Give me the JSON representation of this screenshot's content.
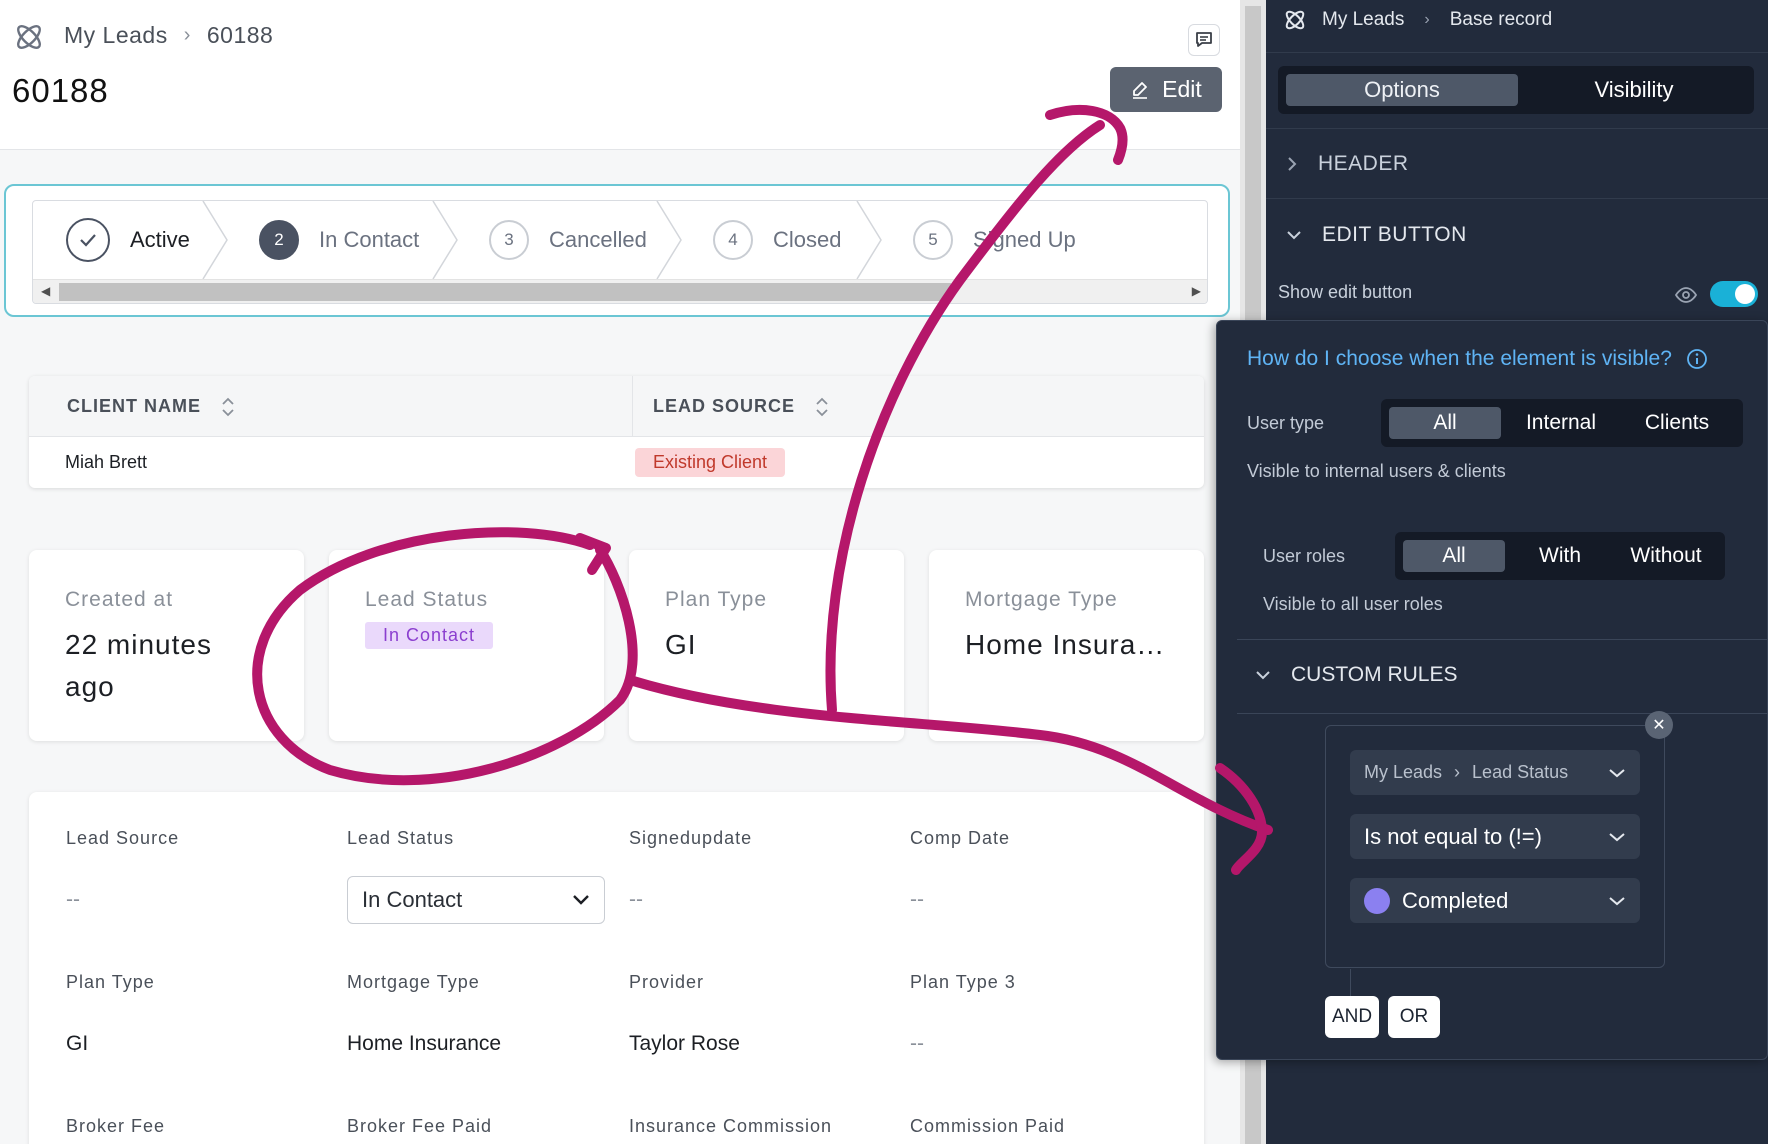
{
  "app": {
    "breadcrumb": {
      "root": "My Leads",
      "current": "60188"
    },
    "record_title": "60188",
    "edit_label": "Edit"
  },
  "stepper": {
    "steps": [
      {
        "num": "",
        "label": "Active",
        "state": "done"
      },
      {
        "num": "2",
        "label": "In Contact",
        "state": "current"
      },
      {
        "num": "3",
        "label": "Cancelled",
        "state": "todo"
      },
      {
        "num": "4",
        "label": "Closed",
        "state": "todo"
      },
      {
        "num": "5",
        "label": "Signed Up",
        "state": "todo"
      }
    ]
  },
  "table": {
    "columns": [
      "CLIENT NAME",
      "LEAD SOURCE"
    ],
    "rows": [
      {
        "client_name": "Miah Brett",
        "lead_source": "Existing Client"
      }
    ]
  },
  "stats": [
    {
      "label": "Created at",
      "value": "22 minutes ago"
    },
    {
      "label": "Lead Status",
      "value": "In Contact"
    },
    {
      "label": "Plan Type",
      "value": "GI"
    },
    {
      "label": "Mortgage Type",
      "value": "Home Insura…"
    }
  ],
  "details": {
    "row1": {
      "lead_source_label": "Lead Source",
      "lead_source_value": "--",
      "lead_status_label": "Lead Status",
      "lead_status_value": "In Contact",
      "signedupdate_label": "Signedupdate",
      "signedupdate_value": "--",
      "comp_date_label": "Comp Date",
      "comp_date_value": "--"
    },
    "row2": {
      "plan_type_label": "Plan Type",
      "plan_type_value": "GI",
      "mortgage_type_label": "Mortgage Type",
      "mortgage_type_value": "Home Insurance",
      "provider_label": "Provider",
      "provider_value": "Taylor Rose",
      "plan_type3_label": "Plan Type 3",
      "plan_type3_value": "--"
    },
    "row3": {
      "broker_fee_label": "Broker Fee",
      "broker_fee_paid_label": "Broker Fee Paid",
      "insurance_commission_label": "Insurance Commission",
      "commission_paid_label": "Commission Paid"
    }
  },
  "panel": {
    "breadcrumb": {
      "root": "My Leads",
      "current": "Base record"
    },
    "tabs": [
      "Options",
      "Visibility"
    ],
    "selected_tab": "Options",
    "sections": {
      "header": "HEADER",
      "edit_button": "EDIT BUTTON"
    },
    "show_edit_label": "Show edit button",
    "show_edit_enabled": true
  },
  "popover": {
    "question": "How do I choose when the element is visible?",
    "user_type": {
      "label": "User type",
      "options": [
        "All",
        "Internal",
        "Clients"
      ],
      "selected": "All",
      "help": "Visible to internal users & clients"
    },
    "user_roles": {
      "label": "User roles",
      "options": [
        "All",
        "With",
        "Without"
      ],
      "selected": "All",
      "help": "Visible to all user roles"
    },
    "custom_rules_label": "CUSTOM RULES",
    "rule": {
      "field_root": "My Leads",
      "field_name": "Lead Status",
      "operator": "Is not equal to (!=)",
      "value": "Completed",
      "value_color": "#8b80f0"
    },
    "and_label": "AND",
    "or_label": "OR"
  },
  "colors": {
    "accent_teal": "#6bc6d4",
    "toggle_on": "#1ab1d7",
    "annotation": "#b5176a",
    "panel_bg": "#222b3c"
  }
}
